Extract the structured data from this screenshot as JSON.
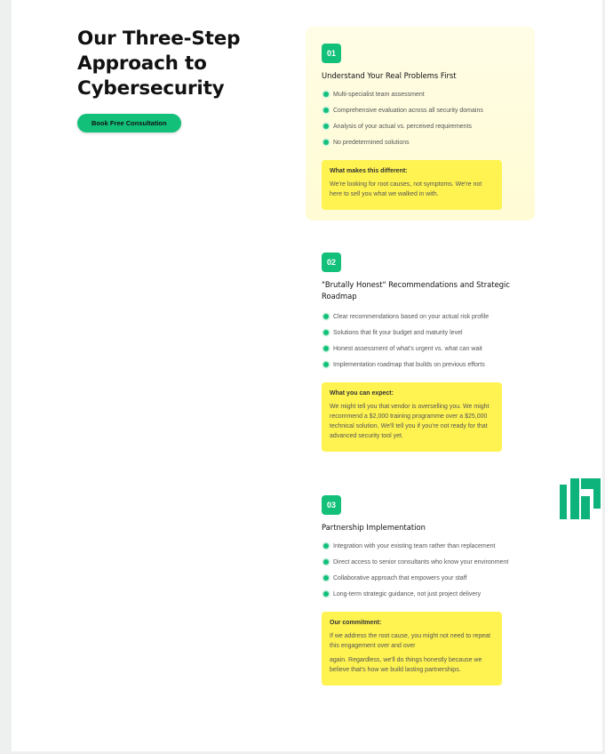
{
  "hero": {
    "title": "Our Three-Step Approach to Cybersecurity",
    "cta_label": "Book Free Consultation"
  },
  "colors": {
    "accent": "#12c07a",
    "highlight": "#fff352",
    "logo": "#0db37a"
  },
  "steps": [
    {
      "number": "01",
      "title": "Understand Your Real Problems First",
      "bullets": [
        "Multi-specialist team assessment",
        "Comprehensive evaluation across all security domains",
        "Analysis of your actual vs. perceived requirements",
        "No predetermined solutions"
      ],
      "note_title": "What makes this different:",
      "note_body": [
        "We're looking for root causes, not symptoms. We're not here to sell you what we walked in with."
      ]
    },
    {
      "number": "02",
      "title": "\"Brutally Honest\" Recommendations and Strategic Roadmap",
      "bullets": [
        "Clear recommendations based on your actual risk profile",
        "Solutions that fit your budget and maturity level",
        "Honest assessment of what's urgent vs. what can wait",
        "Implementation roadmap that builds on previous efforts"
      ],
      "note_title": "What you can expect:",
      "note_body": [
        "We might tell you that vendor is overselling you. We might recommend a $2,000 training programme over a $25,000 technical solution. We'll tell you if you're not ready for that advanced security tool yet."
      ]
    },
    {
      "number": "03",
      "title": "Partnership Implementation",
      "bullets": [
        "Integration with your existing team rather than replacement",
        "Direct access to senior consultants who know your environment",
        "Collaborative approach that empowers your staff",
        "Long-term strategic guidance, not just project delivery"
      ],
      "note_title": "Our commitment:",
      "note_body": [
        "If we address the root cause, you might not need to repeat this engagement over and over",
        "again. Regardless, we'll do things honestly because we believe that's how we build lasting partnerships."
      ]
    }
  ]
}
